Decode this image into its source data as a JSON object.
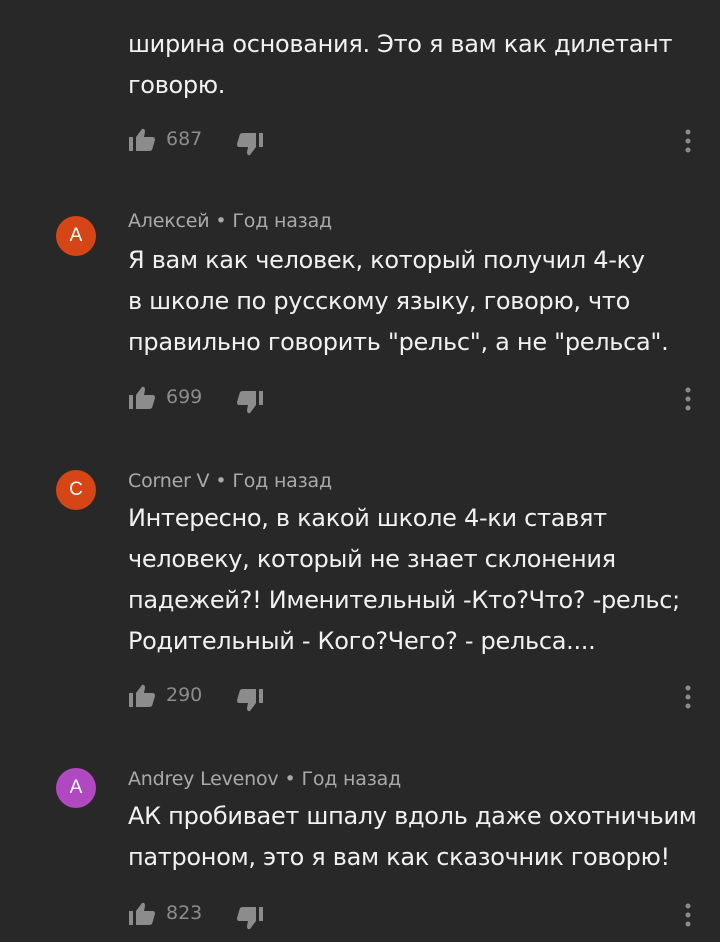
{
  "comments": [
    {
      "author": "",
      "time": "",
      "lines": [
        "ширина основания. Это я вам как дилетант",
        "говорю."
      ],
      "likes": "687"
    },
    {
      "avatar_letter": "А",
      "avatar_color": "#d64516",
      "author": "Алексей",
      "separator": "•",
      "time": "Год назад",
      "lines": [
        "Я вам как человек, который получил 4-ку",
        "в школе по русскому языку, говорю, что",
        "правильно говорить \"рельс\", а не \"рельса\"."
      ],
      "likes": "699"
    },
    {
      "avatar_letter": "C",
      "avatar_color": "#d64516",
      "author": "Corner V",
      "separator": "•",
      "time": "Год назад",
      "lines": [
        "Интересно, в какой школе 4-ки ставят",
        "человеку, который не знает склонения",
        "падежей?! Именительный -Кто?Что? -рельс;",
        "Родительный - Кого?Чего? - рельса...."
      ],
      "likes": "290"
    },
    {
      "avatar_letter": "A",
      "avatar_color": "#b048c2",
      "author": "Andrey Levenov",
      "separator": "•",
      "time": "Год назад",
      "lines": [
        "АК пробивает шпалу вдоль даже охотничьим",
        "патроном, это я вам как сказочник говорю!"
      ],
      "likes": "823"
    }
  ],
  "icons": {
    "like": "thumb-up-icon",
    "dislike": "thumb-down-icon",
    "more": "more-vert-icon"
  },
  "colors": {
    "background": "#282828",
    "text": "#f1f1f1",
    "meta": "#aaaaaa",
    "icon": "#8c8c8c"
  }
}
